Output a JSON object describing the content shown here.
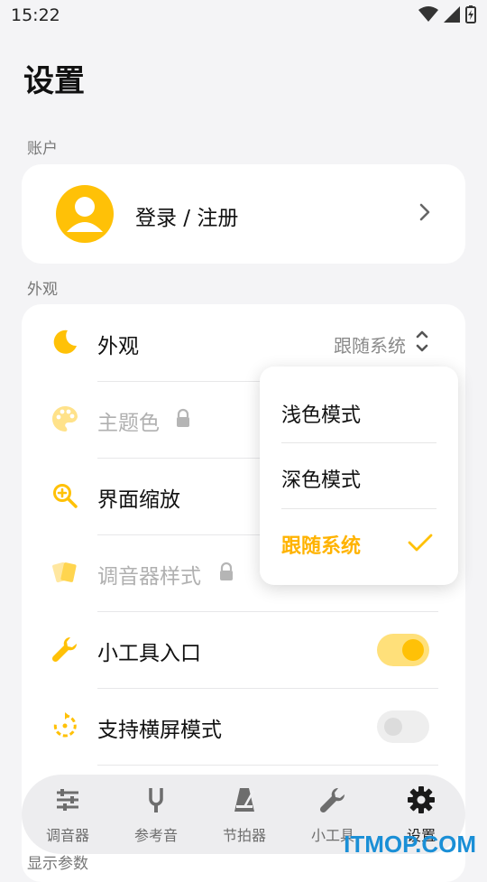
{
  "status_bar": {
    "time": "15:22"
  },
  "page": {
    "title": "设置"
  },
  "sections": {
    "account": "账户",
    "appearance": "外观",
    "display": "显示参数"
  },
  "account": {
    "login_label": "登录 / 注册"
  },
  "appearance_rows": [
    {
      "label": "外观",
      "value": "跟随系统",
      "icon": "moon-icon"
    },
    {
      "label": "主题色",
      "icon": "palette-icon",
      "locked": true
    },
    {
      "label": "界面缩放",
      "icon": "zoom-icon"
    },
    {
      "label": "调音器样式",
      "icon": "cards-icon",
      "locked": true
    },
    {
      "label": "小工具入口",
      "icon": "wrench-icon",
      "toggle": true
    },
    {
      "label": "支持横屏模式",
      "icon": "rotate-icon",
      "toggle": false
    }
  ],
  "dropdown": {
    "options": [
      "浅色模式",
      "深色模式",
      "跟随系统"
    ],
    "selected": "跟随系统"
  },
  "nav": [
    {
      "label": "调音器",
      "icon": "sliders-icon"
    },
    {
      "label": "参考音",
      "icon": "tuning-fork-icon"
    },
    {
      "label": "节拍器",
      "icon": "metronome-icon"
    },
    {
      "label": "小工具",
      "icon": "wrench-icon"
    },
    {
      "label": "设置",
      "icon": "gear-icon",
      "active": true
    }
  ],
  "watermark": "ITMOP.COM",
  "colors": {
    "accent": "#ffc107",
    "background": "#f4f4f6"
  }
}
